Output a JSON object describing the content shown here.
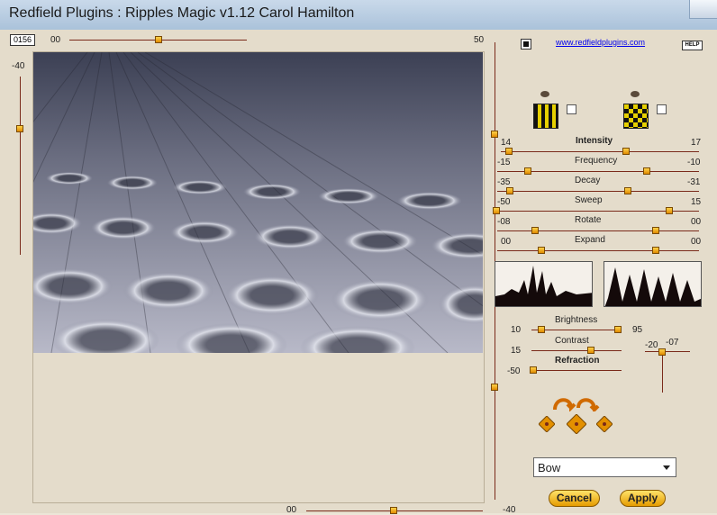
{
  "window": {
    "title": "Redfield Plugins : Ripples Magic v1.12   Carol Hamilton"
  },
  "header": {
    "seed": "0156",
    "top_min": "00",
    "top_max": "50",
    "url": "www.redfieldplugins.com",
    "help": "HELP"
  },
  "left_slider": {
    "value_label": "-40"
  },
  "patterns": {
    "left_icon": "vertical-stripes-pattern-icon",
    "right_icon": "checker-pattern-icon"
  },
  "sliders": [
    {
      "name": "Intensity",
      "left": "14",
      "right": "17",
      "bold": true
    },
    {
      "name": "Frequency",
      "left": "-15",
      "right": "-10"
    },
    {
      "name": "Decay",
      "left": "-35",
      "right": "-31"
    },
    {
      "name": "Sweep",
      "left": "-50",
      "right": "15"
    },
    {
      "name": "Rotate",
      "left": "-08",
      "right": "00"
    },
    {
      "name": "Expand",
      "left": "00",
      "right": "00"
    }
  ],
  "lighting": {
    "brightness_label": "Brightness",
    "brightness_left": "10",
    "brightness_right": "95",
    "contrast_label": "Contrast",
    "contrast_value": "15",
    "refraction_label": "Refraction",
    "refraction_value": "-50",
    "small_left": "-20",
    "small_right": "-07"
  },
  "mode": {
    "selected": "Bow"
  },
  "buttons": {
    "cancel": "Cancel",
    "apply": "Apply"
  },
  "bottom": {
    "left_value": "00",
    "right_value": "-40"
  }
}
